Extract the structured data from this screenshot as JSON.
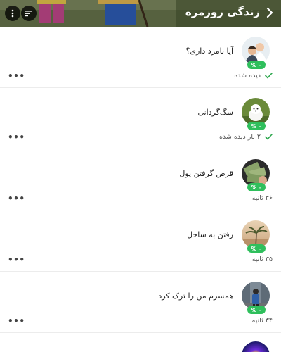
{
  "header": {
    "title": "زندگی روزمره"
  },
  "items": [
    {
      "title": "آیا نامزد داری؟",
      "badge": "۰ %",
      "status": "دیده شده",
      "checked": true
    },
    {
      "title": "سگ‌گردانی",
      "badge": "۰ %",
      "status": "۲ بار دیده شده",
      "checked": true
    },
    {
      "title": "قرض گرفتن پول",
      "badge": "۰ %",
      "status": "۳۶ ثانیه",
      "checked": false
    },
    {
      "title": "رفتن به ساحل",
      "badge": "۰ %",
      "status": "۳۵ ثانیه",
      "checked": false
    },
    {
      "title": "همسرم من را ترک کرد",
      "badge": "۰ %",
      "status": "۳۴ ثانیه",
      "checked": false
    }
  ],
  "colors": {
    "accent_green": "#2fbf5c",
    "check_green": "#2fa84f"
  }
}
